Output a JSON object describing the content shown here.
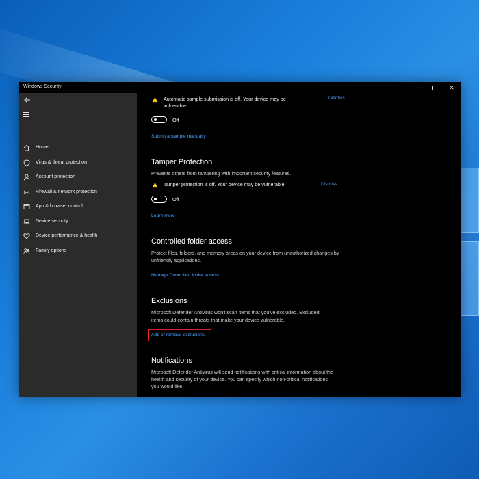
{
  "window": {
    "title": "Windows Security",
    "controls": {
      "minimize": "─",
      "close": "✕"
    }
  },
  "sidebar": {
    "items": [
      {
        "label": "Home",
        "icon": "home-icon"
      },
      {
        "label": "Virus & threat protection",
        "icon": "shield-icon"
      },
      {
        "label": "Account protection",
        "icon": "person-icon"
      },
      {
        "label": "Firewall & network protection",
        "icon": "wifi-icon"
      },
      {
        "label": "App & browser control",
        "icon": "browser-icon"
      },
      {
        "label": "Device security",
        "icon": "laptop-icon"
      },
      {
        "label": "Device performance & health",
        "icon": "heart-icon"
      },
      {
        "label": "Family options",
        "icon": "family-icon"
      }
    ]
  },
  "sample_submission": {
    "warning": "Automatic sample submission is off. Your device may be vulnerable.",
    "dismiss": "Dismiss",
    "toggle_state": "Off",
    "link": "Submit a sample manually"
  },
  "tamper": {
    "heading": "Tamper Protection",
    "description": "Prevents others from tampering with important security features.",
    "warning": "Tamper protection is off. Your device may be vulnerable.",
    "dismiss": "Dismiss",
    "toggle_state": "Off",
    "link": "Learn more"
  },
  "cfa": {
    "heading": "Controlled folder access",
    "description": "Protect files, folders, and memory areas on your device from unauthorized changes by unfriendly applications.",
    "link": "Manage Controlled folder access"
  },
  "exclusions": {
    "heading": "Exclusions",
    "description": "Microsoft Defender Antivirus won't scan items that you've excluded. Excluded items could contain threats that make your device vulnerable.",
    "link": "Add or remove exclusions"
  },
  "notifications": {
    "heading": "Notifications",
    "description": "Microsoft Defender Antivirus will send notifications with critical information about the health and security of your device. You can specify which non-critical notifications you would like."
  },
  "colors": {
    "accent_link": "#4ea4ff",
    "highlight": "#e0232a",
    "warning": "#f5c518",
    "sidebar_bg": "#2b2b2b"
  }
}
